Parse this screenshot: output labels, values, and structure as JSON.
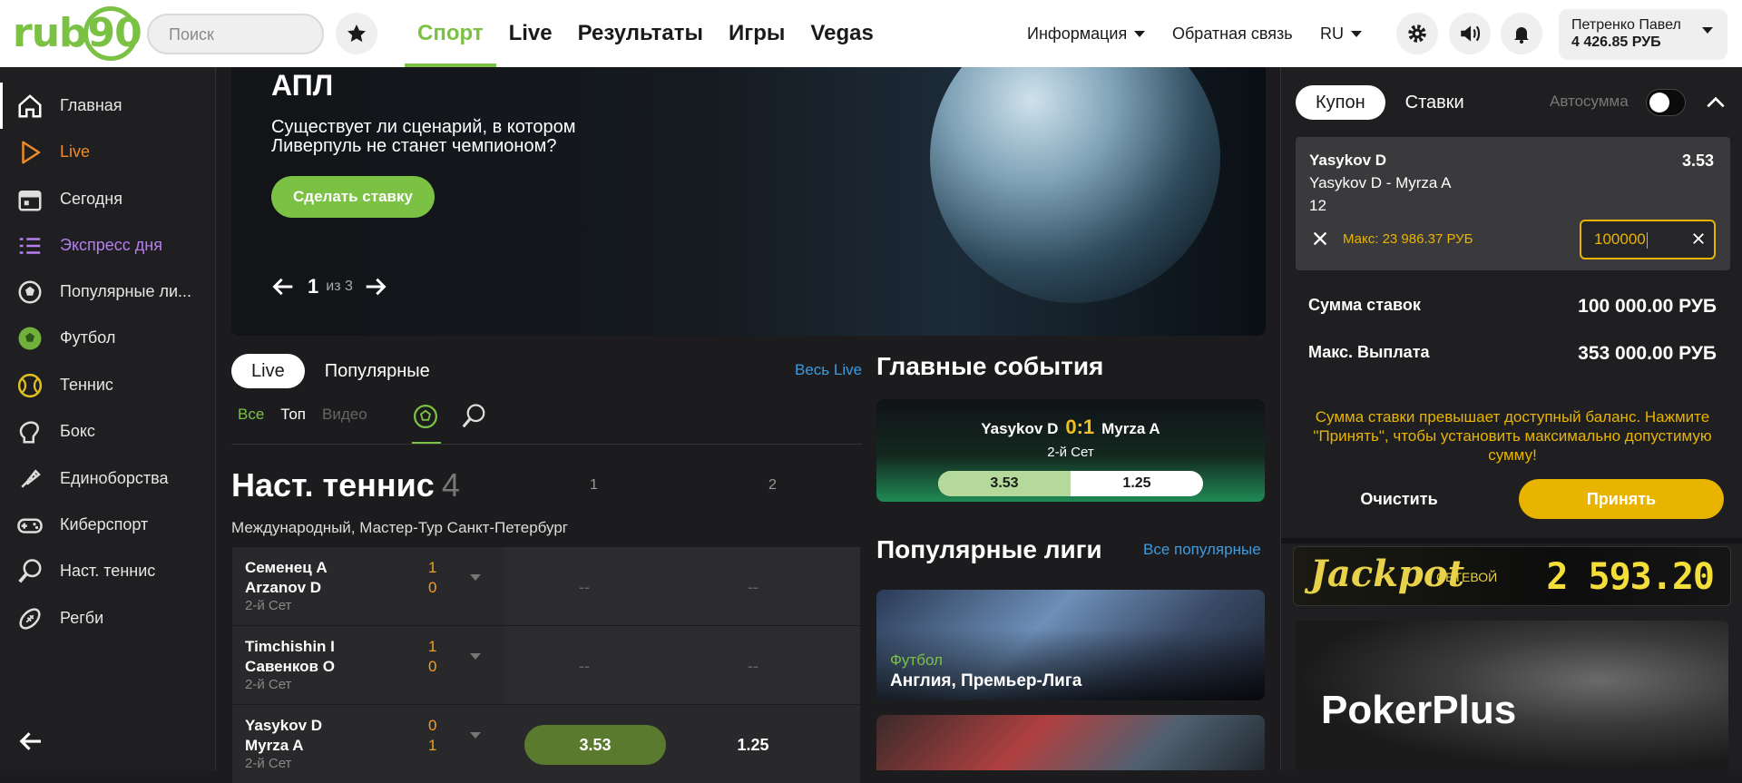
{
  "topbar": {
    "logo": "rub90",
    "search_placeholder": "Поиск",
    "nav": [
      "Спорт",
      "Live",
      "Результаты",
      "Игры",
      "Vegas"
    ],
    "info": "Информация",
    "feedback": "Обратная связь",
    "lang": "RU",
    "user_name": "Петренко Павел",
    "user_balance": "4 426.85 РУБ"
  },
  "sidebar": {
    "items": [
      {
        "label": "Главная",
        "icon": "home-icon"
      },
      {
        "label": "Live",
        "icon": "play-icon"
      },
      {
        "label": "Сегодня",
        "icon": "calendar-icon"
      },
      {
        "label": "Экспресс дня",
        "icon": "list-icon"
      },
      {
        "label": "Популярные ли...",
        "icon": "soccer-ball-icon"
      },
      {
        "label": "Футбол",
        "icon": "football-icon"
      },
      {
        "label": "Теннис",
        "icon": "tennis-ball-icon"
      },
      {
        "label": "Бокс",
        "icon": "boxing-glove-icon"
      },
      {
        "label": "Единоборства",
        "icon": "martial-arts-icon"
      },
      {
        "label": "Киберспорт",
        "icon": "gamepad-icon"
      },
      {
        "label": "Наст. теннис",
        "icon": "table-tennis-icon"
      },
      {
        "label": "Регби",
        "icon": "rugby-ball-icon"
      }
    ]
  },
  "banner": {
    "title": "АПЛ",
    "text": "Существует ли сценарий, в котором Ливерпуль не станет чемпионом?",
    "button": "Сделать ставку",
    "page": "1",
    "of": "из 3"
  },
  "live": {
    "tabs": [
      "Live",
      "Популярные"
    ],
    "all_live": "Весь Live",
    "subtabs": [
      "Все",
      "Топ",
      "Видео"
    ],
    "sport_title": "Наст. теннис",
    "sport_count": "4",
    "col1": "1",
    "col2": "2",
    "tournament": "Международный, Мастер-Тур Санкт-Петербург",
    "matches": [
      {
        "p1": "Семенец А",
        "p2": "Arzanov D",
        "s1": "1",
        "s2": "0",
        "period": "2-й Сет",
        "o1": "--",
        "o2": "--"
      },
      {
        "p1": "Timchishin I",
        "p2": "Савенков О",
        "s1": "1",
        "s2": "0",
        "period": "2-й Сет",
        "o1": "--",
        "o2": "--"
      },
      {
        "p1": "Yasykov D",
        "p2": "Myrza A",
        "s1": "0",
        "s2": "1",
        "period": "2-й Сет",
        "o1": "3.53",
        "o2": "1.25"
      }
    ]
  },
  "main_events": {
    "title": "Главные события",
    "team1": "Yasykov D",
    "score": "0:1",
    "team2": "Myrza A",
    "period": "2-й Сет",
    "odd1": "3.53",
    "odd2": "1.25"
  },
  "popular": {
    "title": "Популярные лиги",
    "link": "Все популярные",
    "leagues": [
      {
        "sport": "Футбол",
        "name": "Англия, Премьер-Лига"
      }
    ]
  },
  "coupon": {
    "tab_coupon": "Купон",
    "tab_bets": "Ставки",
    "autosum": "Автосумма",
    "bet_name": "Yasykov D",
    "bet_match": "Yasykov D - Myrza A",
    "bet_market": "12",
    "bet_odd": "3.53",
    "max": "Макс: 23 986.37 РУБ",
    "stake": "100000",
    "sum_label": "Сумма ставок",
    "sum_value": "100 000.00 РУБ",
    "payout_label": "Макс. Выплата",
    "payout_value": "353 000.00 РУБ",
    "warning": "Сумма ставки превышает доступный баланс. Нажмите \"Принять\", чтобы установить максимально допустимую сумму!",
    "clear": "Очистить",
    "accept": "Принять"
  },
  "promo": {
    "jackpot_title": "Jackpot",
    "jackpot_net": "СЕТЕВОЙ",
    "jackpot_value": "2 593.20",
    "poker_title": "PokerPlus"
  },
  "colors": {
    "accent": "#7bc143",
    "warning": "#e8b400",
    "link": "#3d9be0",
    "score": "#f0a020"
  }
}
